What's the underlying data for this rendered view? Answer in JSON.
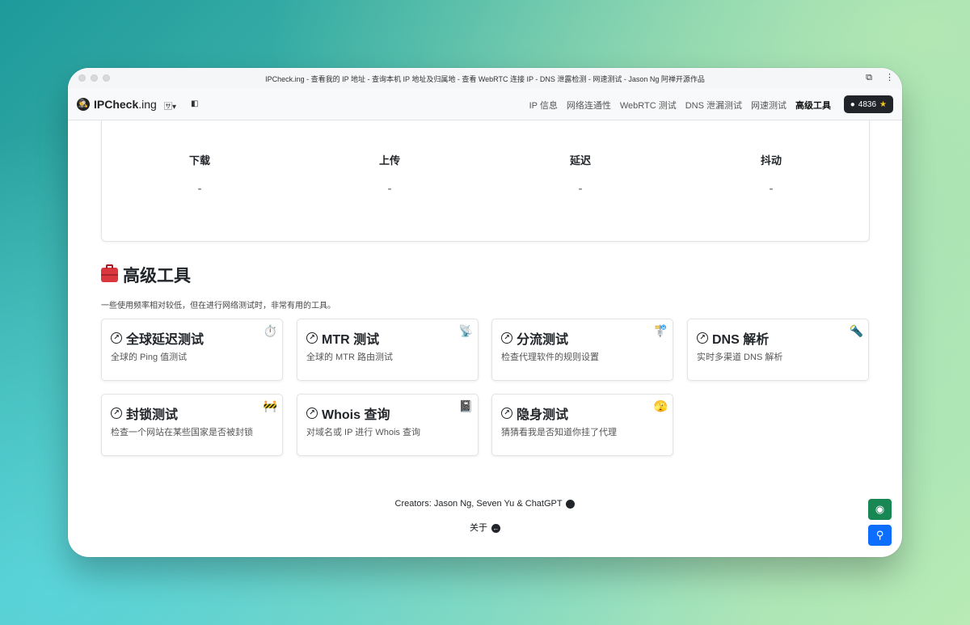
{
  "window": {
    "title": "IPCheck.ing - 查看我的 IP 地址 - 查询本机 IP 地址及归属地 - 查看 WebRTC 连接 IP - DNS 泄露检测 - 网速测试 - Jason Ng 阿禅开源作品"
  },
  "navbar": {
    "brand_bold": "IPCheck",
    "brand_rest": ".ing",
    "links": [
      "IP 信息",
      "网络连通性",
      "WebRTC 测试",
      "DNS 泄漏测试",
      "网速测试",
      "高级工具"
    ],
    "active_link": "高级工具",
    "github_stars": "4836"
  },
  "speedtest": {
    "metrics": [
      {
        "label": "下载",
        "value": "-"
      },
      {
        "label": "上传",
        "value": "-"
      },
      {
        "label": "延迟",
        "value": "-"
      },
      {
        "label": "抖动",
        "value": "-"
      }
    ]
  },
  "advanced": {
    "title": "高级工具",
    "description": "一些使用频率相对较低，但在进行网络测试时，非常有用的工具。",
    "tools": [
      {
        "title": "全球延迟测试",
        "desc": "全球的 Ping 值测试",
        "emoji": "⏱️"
      },
      {
        "title": "MTR 测试",
        "desc": "全球的 MTR 路由测试",
        "emoji": "📡"
      },
      {
        "title": "分流测试",
        "desc": "检查代理软件的规则设置",
        "emoji": "🚏"
      },
      {
        "title": "DNS 解析",
        "desc": "实时多渠道 DNS 解析",
        "emoji": "🔦"
      },
      {
        "title": "封锁测试",
        "desc": "检查一个网站在某些国家是否被封锁",
        "emoji": "🚧"
      },
      {
        "title": "Whois 查询",
        "desc": "对域名或 IP 进行 Whois 查询",
        "emoji": "📓"
      },
      {
        "title": "隐身测试",
        "desc": "猜猜看我是否知道你挂了代理",
        "emoji": "🫣"
      }
    ]
  },
  "footer": {
    "creators": "Creators: Jason Ng, Seven Yu & ChatGPT",
    "about": "关于"
  },
  "icons": {
    "brand": "spy-icon",
    "tool_arrow": "arrow-up-right-circle-icon",
    "float_eye": "eye-icon",
    "float_search": "search-icon"
  },
  "colors": {
    "github_button": "#212529",
    "float_eye_button": "#198754",
    "float_search_button": "#0d6efd"
  }
}
